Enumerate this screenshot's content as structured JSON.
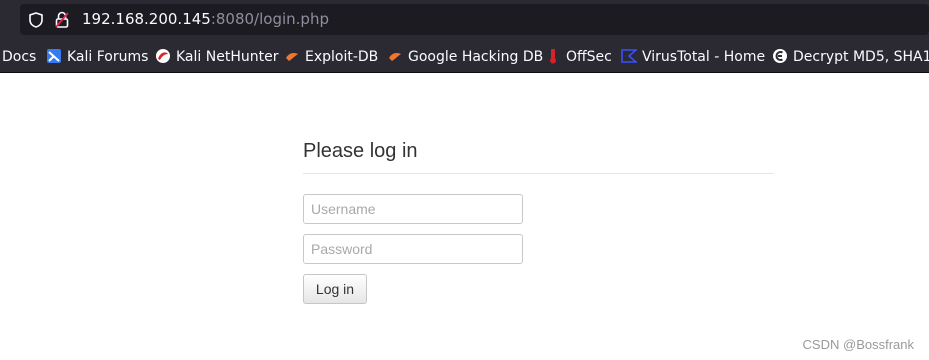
{
  "browser": {
    "url_host": "192.168.200.145",
    "url_rest": ":8080/login.php",
    "bookmarks": [
      {
        "label": "Docs",
        "icon": "none"
      },
      {
        "label": "Kali Forums",
        "icon": "kali-forums-icon"
      },
      {
        "label": "Kali NetHunter",
        "icon": "kali-nethunter-icon"
      },
      {
        "label": "Exploit-DB",
        "icon": "exploit-db-icon"
      },
      {
        "label": "Google Hacking DB",
        "icon": "google-hacking-db-icon"
      },
      {
        "label": "OffSec",
        "icon": "offsec-icon"
      },
      {
        "label": "VirusTotal - Home",
        "icon": "virustotal-icon"
      },
      {
        "label": "Decrypt MD5, SHA1, I",
        "icon": "decrypt-icon"
      }
    ]
  },
  "login": {
    "title": "Please log in",
    "username_placeholder": "Username",
    "password_placeholder": "Password",
    "button_label": "Log in"
  },
  "watermark": "CSDN @Bossfrank",
  "colors": {
    "chrome_bg": "#2b2a33",
    "urlbar_bg": "#1c1b22",
    "page_bg": "#ffffff"
  }
}
